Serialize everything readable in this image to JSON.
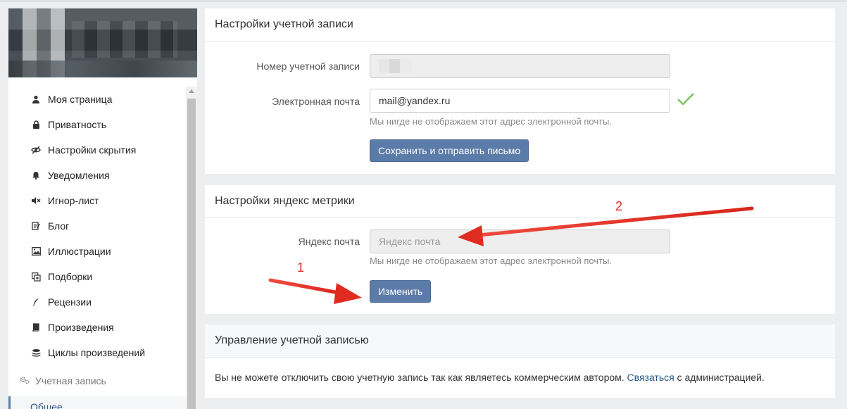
{
  "sidebar": {
    "items": [
      {
        "label": "Моя страница",
        "icon": "user-icon"
      },
      {
        "label": "Приватность",
        "icon": "lock-icon"
      },
      {
        "label": "Настройки скрытия",
        "icon": "eye-slash-icon"
      },
      {
        "label": "Уведомления",
        "icon": "bell-icon"
      },
      {
        "label": "Игнор-лист",
        "icon": "volume-off-icon"
      },
      {
        "label": "Блог",
        "icon": "edit-icon"
      },
      {
        "label": "Иллюстрации",
        "icon": "image-icon"
      },
      {
        "label": "Подборки",
        "icon": "collection-icon"
      },
      {
        "label": "Рецензии",
        "icon": "quill-icon"
      },
      {
        "label": "Произведения",
        "icon": "book-icon"
      },
      {
        "label": "Циклы произведений",
        "icon": "stack-icon"
      }
    ],
    "section": {
      "label": "Учетная запись",
      "icon": "gears-icon"
    },
    "active_subitem": "Общее"
  },
  "account": {
    "title": "Настройки учетной записи",
    "number_label": "Номер учетной записи",
    "email_label": "Электронная почта",
    "email_value": "mail@yandex.ru",
    "email_hint": "Мы нигде не отображаем этот адрес электронной почты.",
    "save_button": "Сохранить и отправить письмо"
  },
  "metrika": {
    "title": "Настройки яндекс метрики",
    "email_label": "Яндекс почта",
    "email_placeholder": "Яндекс почта",
    "email_hint": "Мы нигде не отображаем этот адрес электронной почты.",
    "change_button": "Изменить"
  },
  "management": {
    "title": "Управление учетной записью",
    "text_before": "Вы не можете отключить свою учетную запись так как являетесь коммерческим автором.",
    "link": "Связаться",
    "text_after": "с администрацией."
  },
  "annotations": {
    "one": "1",
    "two": "2"
  },
  "colors": {
    "button": "#5b7ba8",
    "link": "#2a5885",
    "check": "#7ac25b",
    "arrow": "#e02b20"
  }
}
